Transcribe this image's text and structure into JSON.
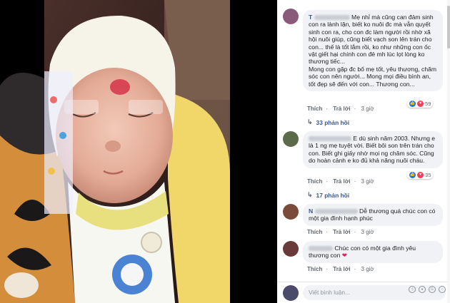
{
  "comments": [
    {
      "author": "T",
      "text_1": "Mẹ nhỉ mà cũng can đảm sinh con ra lành lặn, biết ko nuôi đc mà vẫn quyết sinh con ra, cho con đc làm người rồi nhờ xã hội nuôi giúp, cũng biết vạch son lên trán cho con... thế là tốt lắm rồi, ko như những con ốc vật giết hại chính con đẻ mh lúc lọt lòng ko thương tiếc...",
      "text_2": "Mong con gặp đc bố mẹ tốt, yêu thương, chăm sóc con nên người... Mong mọi điều bình an, tốt đẹp sẽ đến với con... Thương con...",
      "like_label": "Thích",
      "reply_label": "Trả lời",
      "time": "3 giờ",
      "reaction_count": "59",
      "replies_label": "33 phản hồi"
    },
    {
      "author": "",
      "text_1": "E dù sinh năm 2003. Nhưng e là 1 ng mẹ tuyệt vời. Biết bôi son trên trán cho con. Biết ghi giấy nhờ mọi ng chăm sóc. Cũng do hoàn cảnh e ko đủ khả năng nuôi cháu.",
      "like_label": "Thích",
      "reply_label": "Trả lời",
      "time": "3 giờ",
      "reaction_count": "35",
      "replies_label": "17 phản hồi"
    },
    {
      "author": "N",
      "text_1": "Dễ thương quá chúc con có một gia đình hạnh phúc",
      "like_label": "Thích",
      "reply_label": "Trả lời",
      "time": "3 giờ"
    },
    {
      "author": "",
      "text_1": "Chúc con có một gia đình yêu thương con",
      "like_label": "Thích",
      "reply_label": "Trả lời",
      "time": "3 giờ"
    }
  ],
  "composer": {
    "placeholder": "Viết bình luận...",
    "icons": [
      "emoji-icon",
      "camera-icon",
      "gif-icon",
      "sticker-icon"
    ]
  },
  "colors": {
    "link": "#385898",
    "bubble": "#f0f2f5",
    "like": "#1877f2",
    "love": "#f33e58"
  }
}
